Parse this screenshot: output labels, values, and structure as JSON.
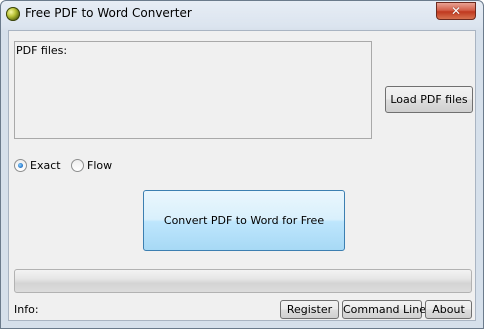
{
  "window": {
    "title": "Free PDF to Word Converter"
  },
  "pdf_files": {
    "label": "PDF files:"
  },
  "buttons": {
    "load": "Load PDF files",
    "convert": "Convert PDF to Word for Free",
    "register": "Register",
    "command_line": "Command Line",
    "about": "About"
  },
  "mode": {
    "options": [
      {
        "label": "Exact",
        "selected": true
      },
      {
        "label": "Flow",
        "selected": false
      }
    ]
  },
  "progress": {
    "value": 0
  },
  "info": {
    "label": "Info:"
  },
  "colors": {
    "close_button": "#c0391f",
    "convert_button_border": "#3c7fb1",
    "radio_selected": "#1f6fc5"
  },
  "icons": {
    "app": "app-icon",
    "close": "close-icon"
  }
}
